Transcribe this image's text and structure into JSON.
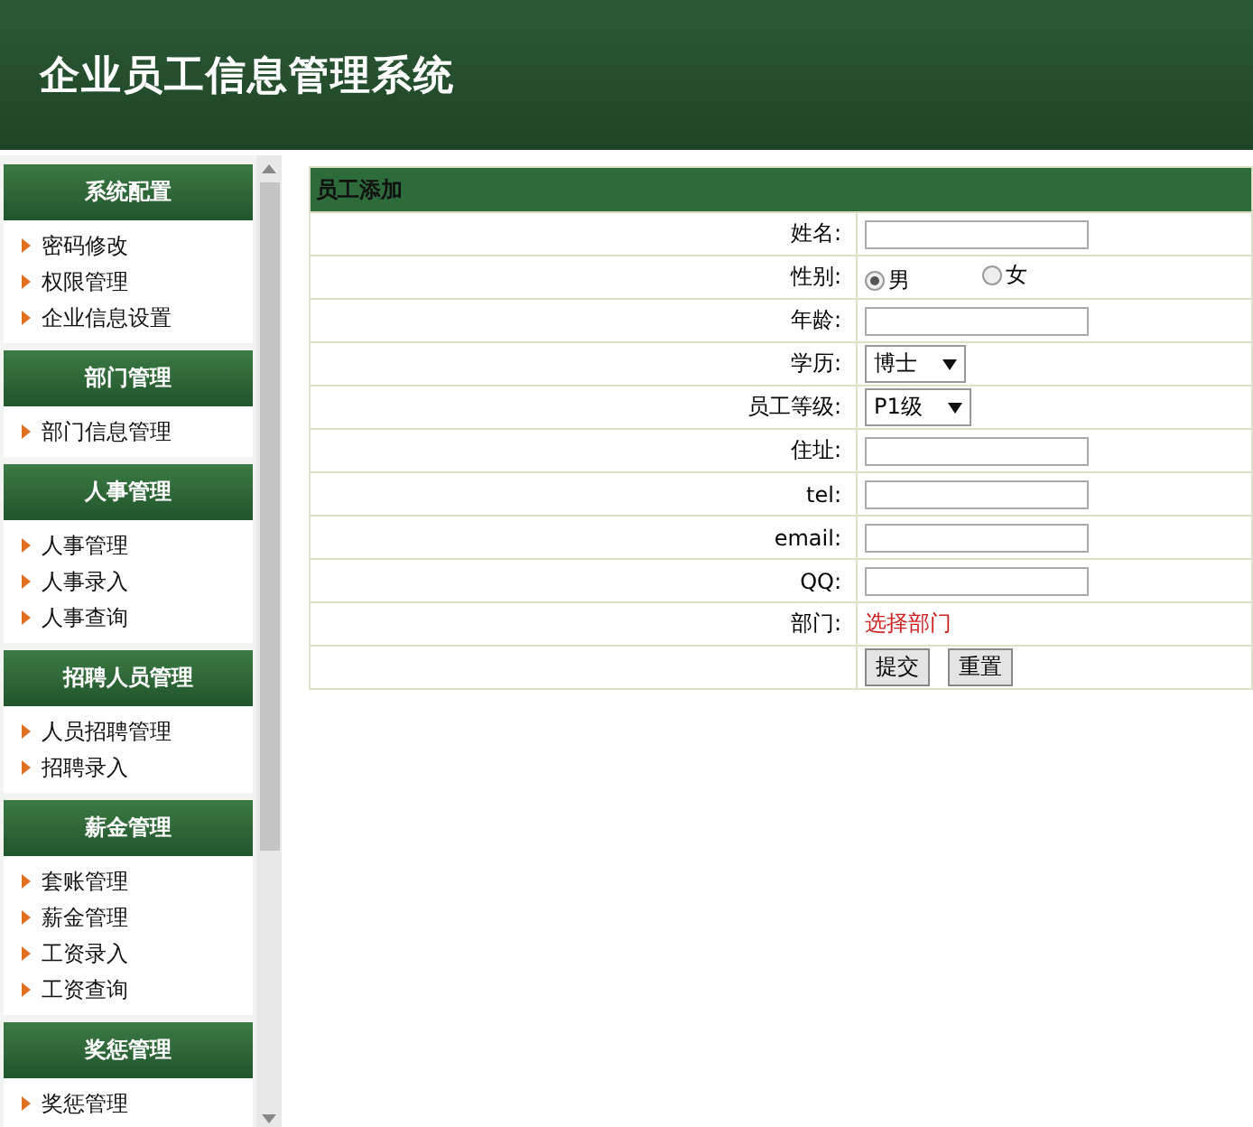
{
  "header": {
    "title": "企业员工信息管理系统"
  },
  "sidebar": {
    "groups": [
      {
        "title": "系统配置",
        "items": [
          "密码修改",
          "权限管理",
          "企业信息设置"
        ]
      },
      {
        "title": "部门管理",
        "items": [
          "部门信息管理"
        ]
      },
      {
        "title": "人事管理",
        "items": [
          "人事管理",
          "人事录入",
          "人事查询"
        ]
      },
      {
        "title": "招聘人员管理",
        "items": [
          "人员招聘管理",
          "招聘录入"
        ]
      },
      {
        "title": "薪金管理",
        "items": [
          "套账管理",
          "薪金管理",
          "工资录入",
          "工资查询"
        ]
      },
      {
        "title": "奖惩管理",
        "items": [
          "奖惩管理"
        ]
      }
    ]
  },
  "form": {
    "title": "员工添加",
    "rows": [
      {
        "kind": "text",
        "label": "姓名:"
      },
      {
        "kind": "radio",
        "label": "性别:",
        "options": [
          {
            "label": "男",
            "selected": true
          },
          {
            "label": "女",
            "selected": false
          }
        ]
      },
      {
        "kind": "text",
        "label": "年龄:"
      },
      {
        "kind": "select",
        "label": "学历:",
        "value": "博士"
      },
      {
        "kind": "select",
        "label": "员工等级:",
        "value": "P1级"
      },
      {
        "kind": "text",
        "label": "住址:"
      },
      {
        "kind": "text",
        "label": "tel:"
      },
      {
        "kind": "text",
        "label": "email:"
      },
      {
        "kind": "text",
        "label": "QQ:"
      },
      {
        "kind": "link",
        "label": "部门:",
        "value": "选择部门"
      },
      {
        "kind": "buttons",
        "buttons": [
          "提交",
          "重置"
        ]
      }
    ]
  }
}
